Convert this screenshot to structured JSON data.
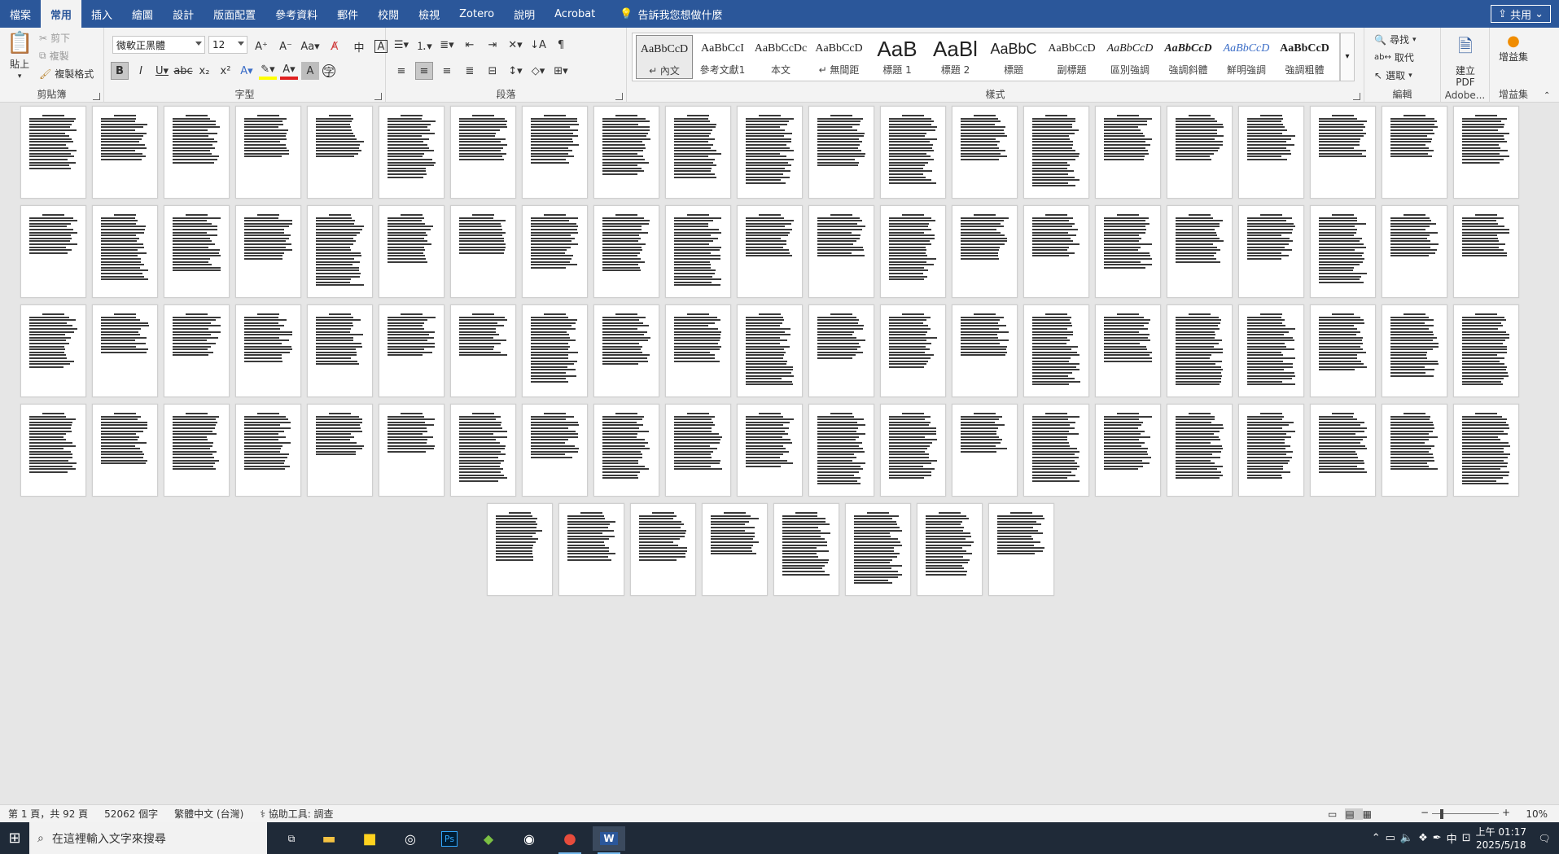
{
  "ribbon_tabs": [
    "檔案",
    "常用",
    "插入",
    "繪圖",
    "設計",
    "版面配置",
    "參考資料",
    "郵件",
    "校閱",
    "檢視",
    "Zotero",
    "說明",
    "Acrobat"
  ],
  "active_tab": "常用",
  "tell_me": "告訴我您想做什麼",
  "share": "共用",
  "clipboard": {
    "label": "剪貼簿",
    "paste": "貼上",
    "cut": "剪下",
    "copy": "複製",
    "format_painter": "複製格式"
  },
  "font": {
    "label": "字型",
    "name": "微軟正黑體",
    "size": "12"
  },
  "paragraph": {
    "label": "段落"
  },
  "styles": {
    "label": "樣式",
    "items": [
      {
        "sample": "AaBbCcD",
        "name": "↵ 內文"
      },
      {
        "sample": "AaBbCcI",
        "name": "參考文獻1"
      },
      {
        "sample": "AaBbCcDc",
        "name": "本文"
      },
      {
        "sample": "AaBbCcD",
        "name": "↵ 無間距"
      },
      {
        "sample": "AaB",
        "name": "標題 1"
      },
      {
        "sample": "AaBl",
        "name": "標題 2"
      },
      {
        "sample": "AaBbC",
        "name": "標題"
      },
      {
        "sample": "AaBbCcD",
        "name": "副標題"
      },
      {
        "sample": "AaBbCcD",
        "name": "區別強調"
      },
      {
        "sample": "AaBbCcD",
        "name": "強調斜體"
      },
      {
        "sample": "AaBbCcD",
        "name": "鮮明強調"
      },
      {
        "sample": "AaBbCcD",
        "name": "強調粗體"
      }
    ]
  },
  "editing": {
    "label": "編輯",
    "find": "尋找",
    "replace": "取代",
    "select": "選取"
  },
  "adobe": {
    "create_pdf": "建立 PDF",
    "label": "Adobe..."
  },
  "addins": {
    "button": "增益集",
    "label": "增益集"
  },
  "status": {
    "page": "第 1 頁，共 92 頁",
    "words": "52062 個字",
    "language": "繁體中文 (台灣)",
    "accessibility": "協助工具: 調查",
    "zoom": "10%"
  },
  "taskbar": {
    "search_placeholder": "在這裡輸入文字來搜尋",
    "time": "上午 01:17",
    "date": "2025/5/18",
    "ime": "中"
  },
  "colors": {
    "accent": "#2b579a",
    "highlight": "#ffff00",
    "font_red": "#e02020"
  }
}
